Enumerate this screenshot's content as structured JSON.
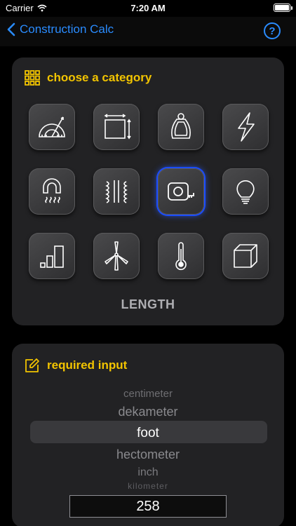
{
  "status_bar": {
    "carrier": "Carrier",
    "time": "7:20 AM"
  },
  "nav": {
    "back_label": "Construction Calc",
    "help_label": "?"
  },
  "category_card": {
    "title": "choose a category",
    "tiles": [
      {
        "icon": "protractor-icon"
      },
      {
        "icon": "area-dimensions-icon"
      },
      {
        "icon": "mass-icon"
      },
      {
        "icon": "lightning-bolt-icon"
      },
      {
        "icon": "magnet-heat-icon"
      },
      {
        "icon": "transformer-coil-icon"
      },
      {
        "icon": "tape-measure-icon",
        "selected": true
      },
      {
        "icon": "light-bulb-icon"
      },
      {
        "icon": "bar-chart-icon"
      },
      {
        "icon": "wind-turbine-icon"
      },
      {
        "icon": "thermometer-icon"
      },
      {
        "icon": "cube-icon"
      }
    ],
    "selected_label": "LENGTH"
  },
  "input_card": {
    "title": "required input",
    "unit_options": [
      "centimeter",
      "dekameter",
      "foot",
      "hectometer",
      "inch",
      "kilometer"
    ],
    "selected_unit": "foot",
    "value": "258"
  },
  "colors": {
    "accent": "#2a8cff",
    "title": "#f2c400",
    "selected_glow": "#1a4cff"
  }
}
